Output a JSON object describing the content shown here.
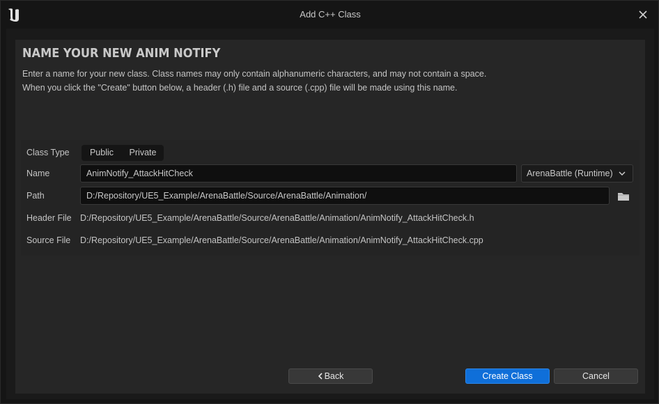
{
  "window": {
    "title": "Add C++ Class",
    "logo_icon": "unreal-engine-logo-icon",
    "close_icon": "close-icon"
  },
  "page": {
    "heading": "NAME YOUR NEW ANIM NOTIFY",
    "description_line1": "Enter a name for your new class. Class names may only contain alphanumeric characters, and may not contain a space.",
    "description_line2": "When you click the \"Create\" button below, a header (.h) file and a source (.cpp) file will be made using this name."
  },
  "form": {
    "class_type_label": "Class Type",
    "class_type_options": [
      "Public",
      "Private"
    ],
    "name_label": "Name",
    "name_value": "AnimNotify_AttackHitCheck",
    "module_value": "ArenaBattle (Runtime)",
    "path_label": "Path",
    "path_value": "D:/Repository/UE5_Example/ArenaBattle/Source/ArenaBattle/Animation/",
    "folder_icon": "folder-icon",
    "header_file_label": "Header File",
    "header_file_value": "D:/Repository/UE5_Example/ArenaBattle/Source/ArenaBattle/Animation/AnimNotify_AttackHitCheck.h",
    "source_file_label": "Source File",
    "source_file_value": "D:/Repository/UE5_Example/ArenaBattle/Source/ArenaBattle/Animation/AnimNotify_AttackHitCheck.cpp"
  },
  "footer": {
    "back_label": "Back",
    "create_label": "Create Class",
    "cancel_label": "Cancel"
  },
  "colors": {
    "accent": "#0f6fd9",
    "background": "#151515",
    "panel": "#262626"
  }
}
